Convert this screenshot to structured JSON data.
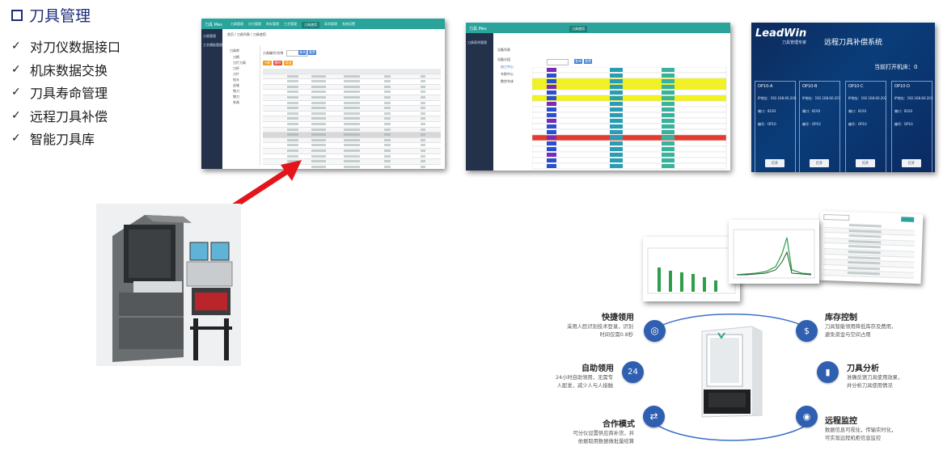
{
  "header": {
    "title": "刀具管理"
  },
  "features": [
    "对刀仪数据接口",
    "机床数据交换",
    "刀具寿命管理",
    "远程刀具补偿",
    "智能刀具库"
  ],
  "screen1": {
    "logo": "刀具 Mes",
    "sidebar": [
      "刀具管理",
      "工艺模板管理"
    ],
    "nav_tabs": [
      "刀具管理",
      "对刀管理",
      "库存管理",
      "工艺管理",
      "刀具使用",
      "寿命管理",
      "系统设置"
    ],
    "active_tab": "刀具使用",
    "breadcrumb": [
      "首页",
      "刀具列表",
      "刀具使用"
    ],
    "left_tree": [
      "刀具库",
      "刀柄",
      "刀片刀具",
      "刀杆",
      "刀片",
      "钻头",
      "丝锥",
      "铣刀",
      "镗刀",
      "夹具"
    ],
    "buttons": [
      "+新增",
      "删除",
      "导出"
    ],
    "search_label": "刀具编号/名称",
    "search_btns": [
      "查询",
      "重置"
    ]
  },
  "screen2": {
    "logo": "刀具 Mes",
    "sidebar": [
      "刀具寿命管理"
    ],
    "active_tab": "刀具使用",
    "title": "设备列表",
    "tree": [
      "设备分组",
      "加工中心",
      "车削中心",
      "数控车床"
    ],
    "search_btns": [
      "查询",
      "重置"
    ]
  },
  "screen3": {
    "logo": "LeadWin",
    "sub": "刀具管理专家",
    "title": "远程刀具补偿系统",
    "online_label": "当前打开机床：0",
    "panels": [
      {
        "name": "OP10-A",
        "ip": "IP地址：192.168.60.200"
      },
      {
        "name": "OP10-B",
        "ip": "IP地址：192.168.60.201"
      },
      {
        "name": "OP10-C",
        "ip": "IP地址：192.168.60.202"
      },
      {
        "name": "OP10-D",
        "ip": "IP地址：192.168.60.203"
      }
    ],
    "panel_fields": [
      "端口：8193",
      "编号：OP10",
      "状态：离线"
    ],
    "open_button": "打开"
  },
  "diagram": {
    "items": [
      {
        "title": "快捷领用",
        "desc": [
          "采用人脸识别技术登录，识别",
          "时间仅需0.8秒"
        ],
        "icon": "target-icon"
      },
      {
        "title": "自助领用",
        "desc": [
          "24小时自助领用，无需专",
          "人配发，减少人与人接触"
        ],
        "icon": "24h-icon"
      },
      {
        "title": "合作模式",
        "desc": [
          "可分仪设置供应商补货，并",
          "依据取用数据做批量结算"
        ],
        "icon": "handshake-icon"
      },
      {
        "title": "库存控制",
        "desc": [
          "刀具智能领用降低库存及费用，",
          "避免资金与空间占用"
        ],
        "icon": "money-icon"
      },
      {
        "title": "刀具分析",
        "desc": [
          "准确反馈刀具使用效果，",
          "并分析刀具使用情况"
        ],
        "icon": "analysis-icon"
      },
      {
        "title": "远程监控",
        "desc": [
          "数据信息可视化，传输实时化，",
          "可实现远程机柜信息监控"
        ],
        "icon": "monitor-icon"
      }
    ]
  },
  "colors": {
    "title": "#1e2c7a",
    "teal": "#2aa39b",
    "sidebar": "#23324a",
    "arrow": "#e3151a",
    "icon_blue": "#2f5fb0"
  }
}
